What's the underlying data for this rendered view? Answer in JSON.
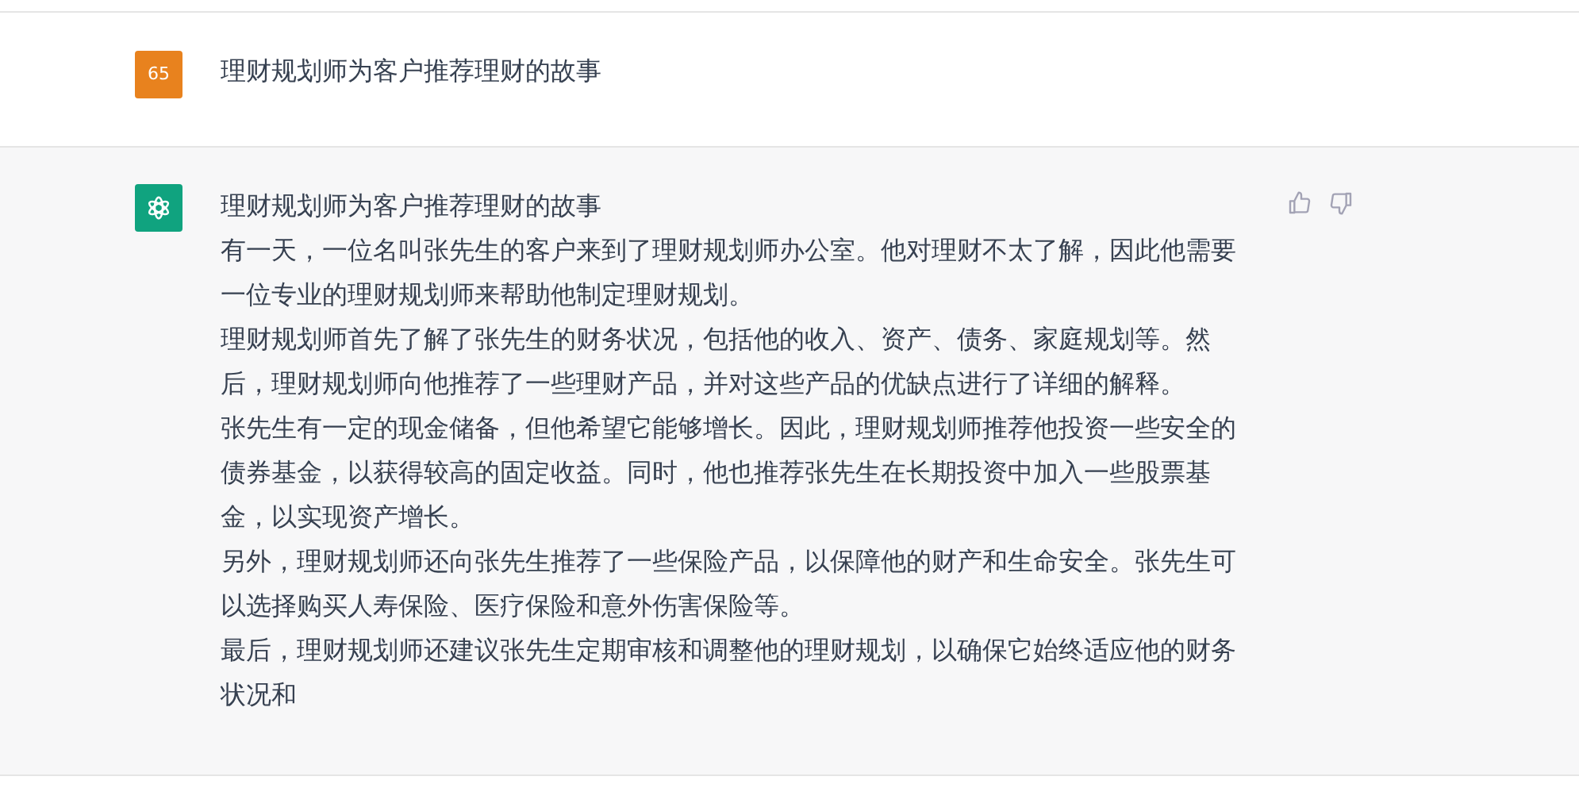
{
  "messages": [
    {
      "kind": "user",
      "avatar_text": "65",
      "color": "#e8821e",
      "paragraphs": [
        "理财规划师为客户推荐理财的故事"
      ]
    },
    {
      "kind": "assistant",
      "color": "#10a37f",
      "paragraphs": [
        "理财规划师为客户推荐理财的故事",
        "有一天，一位名叫张先生的客户来到了理财规划师办公室。他对理财不太了解，因此他需要一位专业的理财规划师来帮助他制定理财规划。",
        "理财规划师首先了解了张先生的财务状况，包括他的收入、资产、债务、家庭规划等。然后，理财规划师向他推荐了一些理财产品，并对这些产品的优缺点进行了详细的解释。",
        "张先生有一定的现金储备，但他希望它能够增长。因此，理财规划师推荐他投资一些安全的债券基金，以获得较高的固定收益。同时，他也推荐张先生在长期投资中加入一些股票基金，以实现资产增长。",
        "另外，理财规划师还向张先生推荐了一些保险产品，以保障他的财产和生命安全。张先生可以选择购买人寿保险、医疗保险和意外伤害保险等。",
        "最后，理财规划师还建议张先生定期审核和调整他的理财规划，以确保它始终适应他的财务状况和"
      ]
    }
  ]
}
